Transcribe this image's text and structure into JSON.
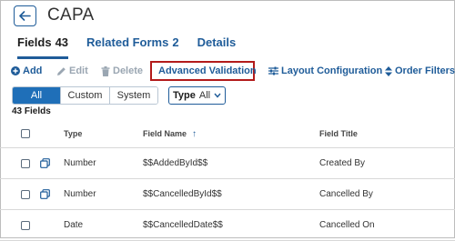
{
  "header": {
    "title": "CAPA"
  },
  "tabs": [
    {
      "label": "Fields",
      "count": "43"
    },
    {
      "label": "Related Forms",
      "count": "2"
    },
    {
      "label": "Details",
      "count": ""
    }
  ],
  "toolbar": {
    "add": "Add",
    "edit": "Edit",
    "delete": "Delete",
    "advanced_validation": "Advanced Validation",
    "layout_configuration": "Layout Configuration",
    "order_filters": "Order Filters"
  },
  "filters": {
    "segments": [
      "All",
      "Custom",
      "System"
    ],
    "active_segment": "All",
    "type_label": "Type",
    "type_value": "All"
  },
  "field_count": "43 Fields",
  "table": {
    "columns": {
      "type": "Type",
      "field_name": "Field Name",
      "field_title": "Field Title"
    },
    "rows": [
      {
        "type": "Number",
        "field_name": "$$AddedById$$",
        "field_title": "Created By"
      },
      {
        "type": "Number",
        "field_name": "$$CancelledById$$",
        "field_title": "Cancelled By"
      },
      {
        "type": "Date",
        "field_name": "$$CancelledDate$$",
        "field_title": "Cancelled On"
      }
    ]
  },
  "colors": {
    "accent": "#1f5c99",
    "active_segment": "#1f6fb8",
    "highlight_border": "#b31b1b",
    "disabled": "#9aa6b2"
  }
}
